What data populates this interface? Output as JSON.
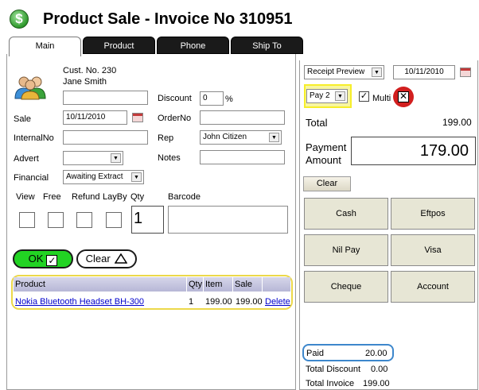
{
  "title": {
    "text": "Product Sale - Invoice No 310951",
    "icon": "dollar-icon"
  },
  "tabs": [
    {
      "label": "Main",
      "active": true
    },
    {
      "label": "Product",
      "active": false
    },
    {
      "label": "Phone",
      "active": false
    },
    {
      "label": "Ship To",
      "active": false
    }
  ],
  "customer": {
    "number": "Cust. No. 230",
    "name": "Jane Smith",
    "icon": "customers-icon"
  },
  "form": {
    "discount_label": "Discount",
    "discount_value": "0",
    "discount_unit": "%",
    "sale_label": "Sale",
    "sale_value": "10/11/2010",
    "orderno_label": "OrderNo",
    "orderno_value": "",
    "internalno_label": "InternalNo",
    "internalno_value": "",
    "rep_label": "Rep",
    "rep_value": "John Citizen",
    "advert_label": "Advert",
    "advert_value": "",
    "notes_label": "Notes",
    "notes_value": "",
    "financial_label": "Financial",
    "financial_value": "Awaiting Extract",
    "top_blank_value": ""
  },
  "flags": {
    "view_label": "View",
    "free_label": "Free",
    "refund_label": "Refund",
    "layby_label": "LayBy",
    "qty_label": "Qty",
    "qty_value": "1",
    "barcode_label": "Barcode",
    "barcode_value": ""
  },
  "actions": {
    "ok_label": "OK",
    "clear_label": "Clear"
  },
  "items_table": {
    "headers": [
      "Product",
      "Qty",
      "Item",
      "Sale",
      ""
    ],
    "rows": [
      {
        "product": "Nokia Bluetooth Headset BH-300",
        "qty": "1",
        "item": "199.00",
        "sale": "199.00",
        "action": "Delete"
      }
    ]
  },
  "right": {
    "receipt_select": "Receipt Preview",
    "receipt_date": "10/11/2010",
    "pay_select": "Pay 2",
    "multi_label": "Multi",
    "multi_checked": true,
    "total_label": "Total",
    "total_value": "199.00",
    "payment_label_1": "Payment",
    "payment_label_2": "Amount",
    "payment_value": "179.00",
    "clear_label": "Clear",
    "buttons": [
      "Cash",
      "Eftpos",
      "Nil Pay",
      "Visa",
      "Cheque",
      "Account"
    ],
    "paid_label": "Paid",
    "paid_value": "20.00",
    "total_discount_label": "Total Discount",
    "total_discount_value": "0.00",
    "total_invoice_label": "Total Invoice",
    "total_invoice_value": "199.00"
  },
  "colors": {
    "ok_green": "#22d323",
    "highlight_yellow": "#ecd84a",
    "paid_blue": "#3d87cc",
    "cancel_red": "#d21f1f"
  }
}
